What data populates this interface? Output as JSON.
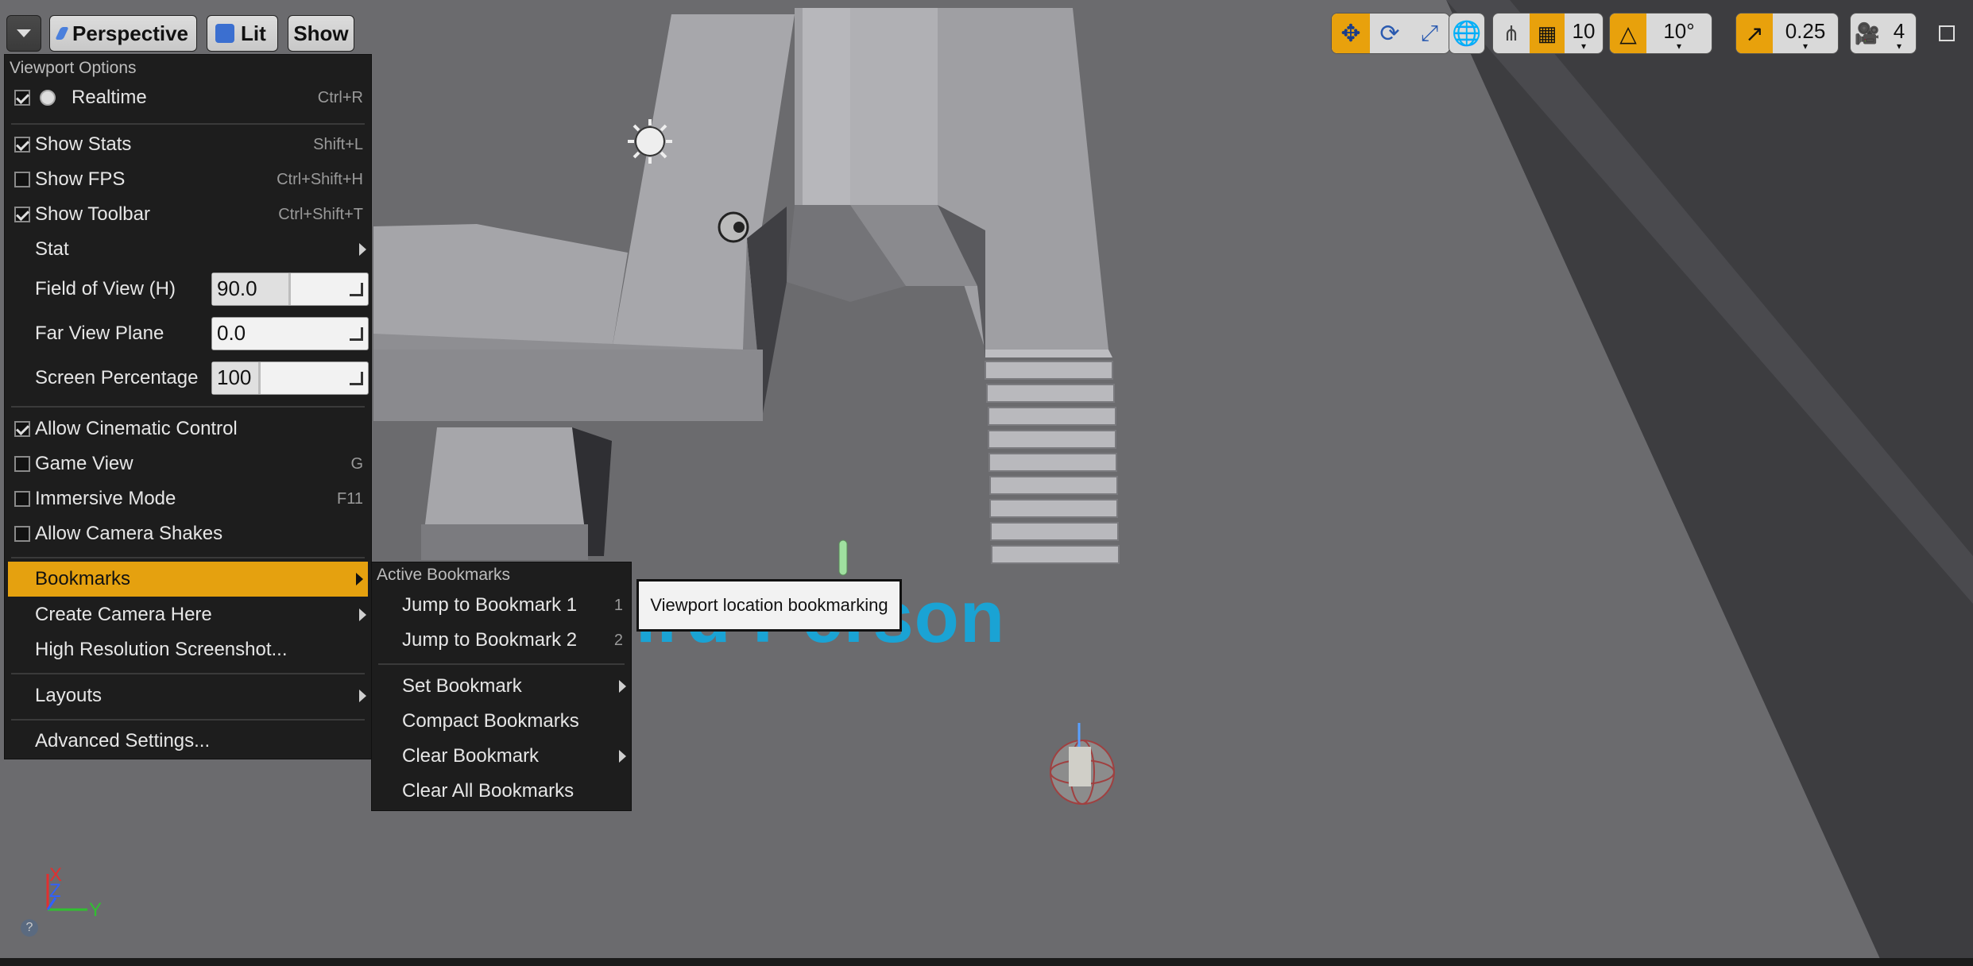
{
  "toolbar": {
    "perspective_label": "Perspective",
    "lit_label": "Lit",
    "show_label": "Show",
    "grid_snap_value": "10",
    "rotation_snap_value": "10°",
    "scale_snap_value": "0.25",
    "camera_speed_value": "4"
  },
  "viewport_menu": {
    "header": "Viewport Options",
    "realtime": {
      "label": "Realtime",
      "shortcut": "Ctrl+R"
    },
    "show_stats": {
      "label": "Show Stats",
      "shortcut": "Shift+L"
    },
    "show_fps": {
      "label": "Show FPS",
      "shortcut": "Ctrl+Shift+H"
    },
    "show_toolbar": {
      "label": "Show Toolbar",
      "shortcut": "Ctrl+Shift+T"
    },
    "stat": {
      "label": "Stat"
    },
    "fov": {
      "label": "Field of View (H)",
      "value": "90.0"
    },
    "far_view_plane": {
      "label": "Far View Plane",
      "value": "0.0"
    },
    "screen_percentage": {
      "label": "Screen Percentage",
      "value": "100"
    },
    "allow_cinematic_control": {
      "label": "Allow Cinematic Control"
    },
    "game_view": {
      "label": "Game View",
      "shortcut": "G"
    },
    "immersive_mode": {
      "label": "Immersive Mode",
      "shortcut": "F11"
    },
    "allow_camera_shakes": {
      "label": "Allow Camera Shakes"
    },
    "bookmarks": {
      "label": "Bookmarks"
    },
    "create_camera_here": {
      "label": "Create Camera Here"
    },
    "high_res_screenshot": {
      "label": "High Resolution Screenshot..."
    },
    "layouts": {
      "label": "Layouts"
    },
    "advanced_settings": {
      "label": "Advanced Settings..."
    }
  },
  "bookmarks_menu": {
    "header": "Active Bookmarks",
    "jump1": {
      "label": "Jump to Bookmark 1",
      "shortcut": "1"
    },
    "jump2": {
      "label": "Jump to Bookmark 2",
      "shortcut": "2"
    },
    "set_bookmark": {
      "label": "Set Bookmark"
    },
    "compact_bookmarks": {
      "label": "Compact Bookmarks"
    },
    "clear_bookmark": {
      "label": "Clear Bookmark"
    },
    "clear_all_bookmarks": {
      "label": "Clear All Bookmarks"
    }
  },
  "tooltip": {
    "text": "Viewport location bookmarking"
  },
  "scene": {
    "text_render": "ird Person"
  },
  "axis": {
    "x_label": "X",
    "y_label": "Y",
    "z_label": "Z"
  },
  "checks": {
    "realtime": true,
    "show_stats": true,
    "show_fps": false,
    "show_toolbar": true,
    "allow_cinematic_control": true,
    "game_view": false,
    "immersive_mode": false,
    "allow_camera_shakes": false
  },
  "colors": {
    "accent": "#e5a10f",
    "menu_bg": "#1d1d1d",
    "text_render": "#1aa3d4"
  }
}
